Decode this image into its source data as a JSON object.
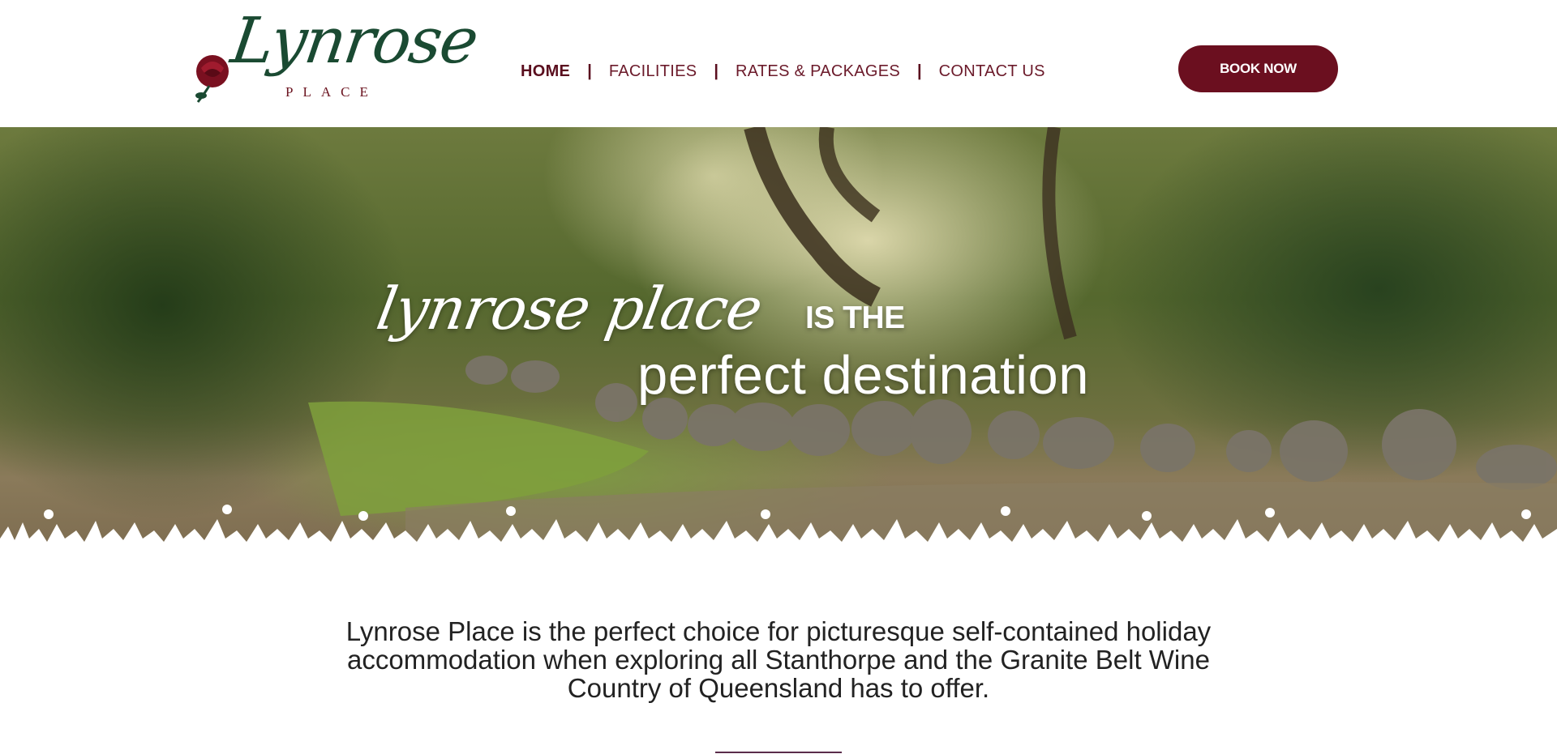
{
  "header": {
    "logo": {
      "name": "Lynrose",
      "sub": "PLACE"
    },
    "nav": [
      {
        "label": "HOME",
        "active": true
      },
      {
        "label": "FACILITIES",
        "active": false
      },
      {
        "label": "RATES & PACKAGES",
        "active": false
      },
      {
        "label": "CONTACT US",
        "active": false
      }
    ],
    "separator": "|",
    "book_label": "BOOK NOW"
  },
  "hero": {
    "title_script": "lynrose place",
    "title_small": "IS THE",
    "title_sub": "perfect destination"
  },
  "intro": {
    "text": "Lynrose Place is the perfect choice for picturesque self-contained holiday accommodation when exploring all Stanthorpe and the Granite Belt Wine Country of Queensland has to offer."
  },
  "colors": {
    "brand": "#6b0f1f",
    "logo_green": "#1a4a32"
  }
}
